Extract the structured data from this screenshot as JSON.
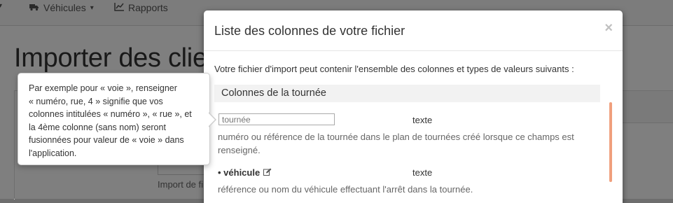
{
  "navbar": {
    "items": [
      {
        "label": "Véhicules",
        "icon": "truck-icon",
        "has_caret": true
      },
      {
        "label": "Rapports",
        "icon": "line-chart-icon",
        "has_caret": false
      }
    ]
  },
  "page": {
    "title": "Importer des clients",
    "help_text": "Import de fichier"
  },
  "modal": {
    "title": "Liste des colonnes de votre fichier",
    "close_label": "×",
    "intro": "Votre fichier d'import peut contenir l'ensemble des colonnes et types de valeurs suivants :",
    "section_title": "Colonnes de la tournée",
    "fields": [
      {
        "name": "",
        "placeholder": "tournée",
        "type": "texte",
        "description_lines": [
          "numéro ou référence de la tournée dans le plan de tournées créé lorsque ce champs est",
          "renseigné."
        ]
      },
      {
        "name": "• véhicule",
        "type": "texte",
        "description_lines": [
          "référence ou nom du véhicule effectuant l'arrêt dans la tournée."
        ]
      }
    ]
  },
  "popover": {
    "lines": [
      "Par exemple pour « voie », renseigner",
      "« numéro, rue, 4 » signifie que vos",
      "colonnes intitulées « numéro », « rue », et",
      "la 4ème colonne (sans nom) seront",
      "fusionnées pour valeur de « voie » dans",
      "l'application."
    ]
  },
  "colors": {
    "overlay": "rgba(0,0,0,0.5)",
    "scrollbar_accent": "#f0a07d",
    "section_bg": "#f2f2f2"
  }
}
